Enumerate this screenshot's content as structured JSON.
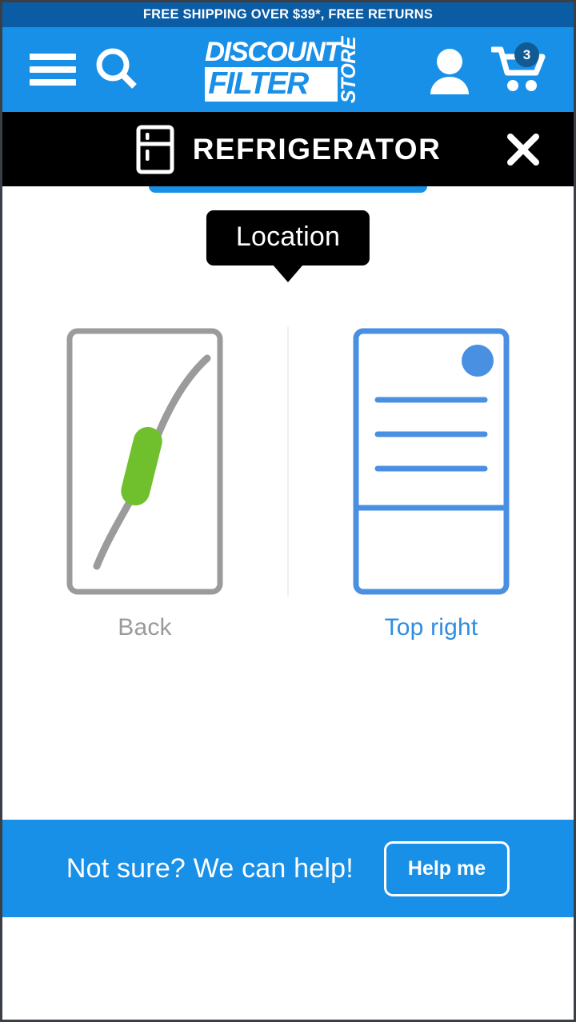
{
  "announcement": {
    "text": "FREE SHIPPING OVER $39*, FREE RETURNS",
    "bg_color": "#0a5ca4"
  },
  "header": {
    "bg_color": "#1890e8",
    "menu_icon": "hamburger-icon",
    "search_icon": "search-icon",
    "account_icon": "user-icon",
    "cart_icon": "shopping-cart-icon",
    "cart_count": "3",
    "cart_badge_color": "#115b94",
    "logo": {
      "line1": "DISCOUNT",
      "line2": "FILTER",
      "line3": "STORE"
    }
  },
  "category_bar": {
    "bg_color": "#000000",
    "icon": "refrigerator-icon",
    "title": "REFRIGERATOR",
    "close_icon": "close-x-icon"
  },
  "step": {
    "tooltip_label": "Location",
    "options": [
      {
        "label": "Back",
        "art": "fridge-back-waterline-filter",
        "state": "unselected",
        "color": "#9a9a9a",
        "accent_color": "#6fc02c"
      },
      {
        "label": "Top right",
        "art": "fridge-front-top-right-filter",
        "state": "selected",
        "color": "#2f8de0",
        "accent_color": "#4a90e2"
      }
    ]
  },
  "help_bar": {
    "bg_color": "#1890e8",
    "text": "Not sure? We can help!",
    "button_label": "Help me"
  }
}
